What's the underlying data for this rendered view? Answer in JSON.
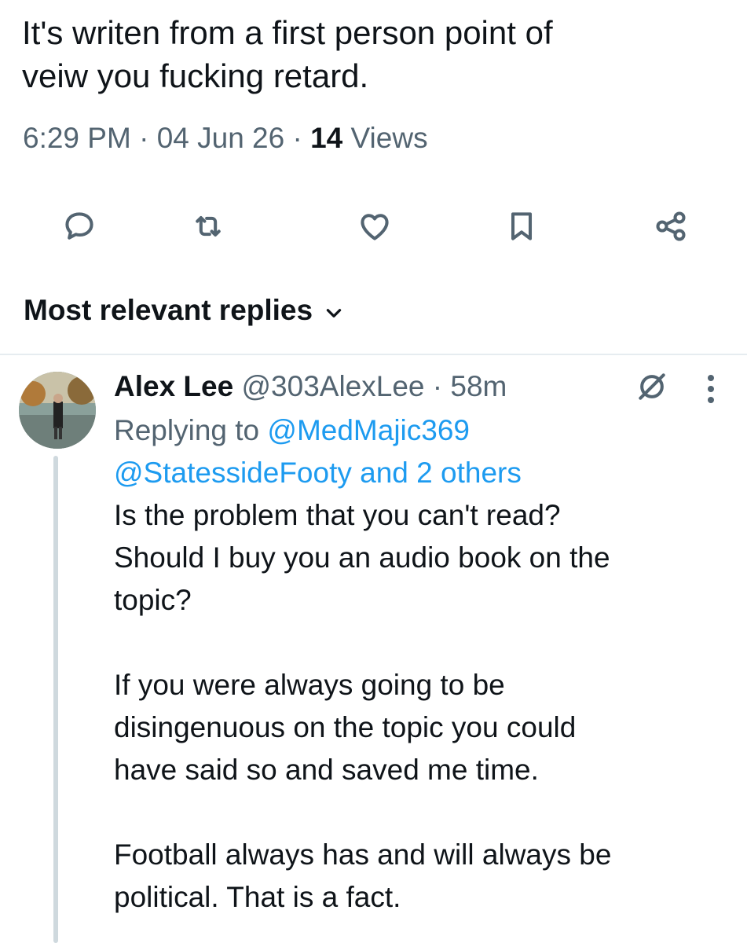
{
  "tweet": {
    "text_line1": "It's writen from a first person point of",
    "text_line2": "veiw you fucking retard.",
    "time": "6:29 PM",
    "sep1": "·",
    "date": "04 Jun 26",
    "sep2": "·",
    "views_count": "14",
    "views_label": "Views"
  },
  "actions": {
    "reply": "reply-icon",
    "retweet": "retweet-icon",
    "like": "heart-icon",
    "bookmark": "bookmark-icon",
    "share": "share-icon"
  },
  "replies": {
    "sort_label": "Most relevant replies"
  },
  "reply": {
    "name": "Alex Lee",
    "handle": "@303AlexLee",
    "sep": "·",
    "age": "58m",
    "replying_prefix": "Replying to",
    "replying_user1": "@MedMajic369",
    "replying_user2": "@StatessideFooty and 2 others",
    "p1_l1": "Is the problem that you can't read?",
    "p1_l2": "Should I buy you an audio book on the",
    "p1_l3": "topic?",
    "p2_l1": "If you were always going to be",
    "p2_l2": "disingenuous on the topic you could",
    "p2_l3": "have said so and saved me time.",
    "p3_l1": "Football always has and will always be",
    "p3_l2": "political. That is a fact."
  },
  "colors": {
    "text": "#0f1419",
    "muted": "#536471",
    "link": "#1d9bf0",
    "divider": "#e6ecf0"
  }
}
